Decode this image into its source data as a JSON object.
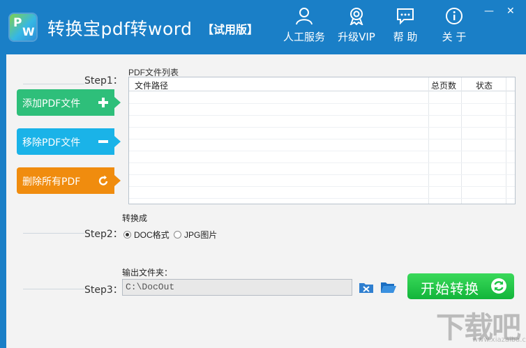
{
  "window": {
    "title": "转换宝pdf转word",
    "edition": "【试用版】",
    "minimize": "—",
    "close": "✕"
  },
  "nav": [
    {
      "label": "人工服务",
      "icon": "person-icon"
    },
    {
      "label": "升级VIP",
      "icon": "vip-badge-icon"
    },
    {
      "label": "帮 助",
      "icon": "chat-help-icon"
    },
    {
      "label": "关 于",
      "icon": "info-icon"
    }
  ],
  "steps": {
    "step1": "Step1：",
    "step2": "Step2：",
    "step3": "Step3："
  },
  "actions": {
    "add": "添加PDF文件",
    "remove": "移除PDF文件",
    "clear": "删除所有PDF"
  },
  "file_list": {
    "title": "PDF文件列表",
    "columns": [
      "文件路径",
      "总页数",
      "状态"
    ],
    "rows": []
  },
  "convert": {
    "label": "转换成",
    "options": [
      "DOC格式",
      "JPG图片"
    ],
    "selected": "DOC格式"
  },
  "output": {
    "label": "输出文件夹：",
    "path": "C:\\DocOut"
  },
  "start_button": "开始转换",
  "watermark": {
    "main": "下载吧",
    "sub": "www.xiazaiba.com"
  },
  "colors": {
    "titlebar": "#1a7fc7",
    "add": "#2ebf7a",
    "remove": "#1ab3e8",
    "clear": "#f08c0e",
    "start": "#1fc446"
  }
}
